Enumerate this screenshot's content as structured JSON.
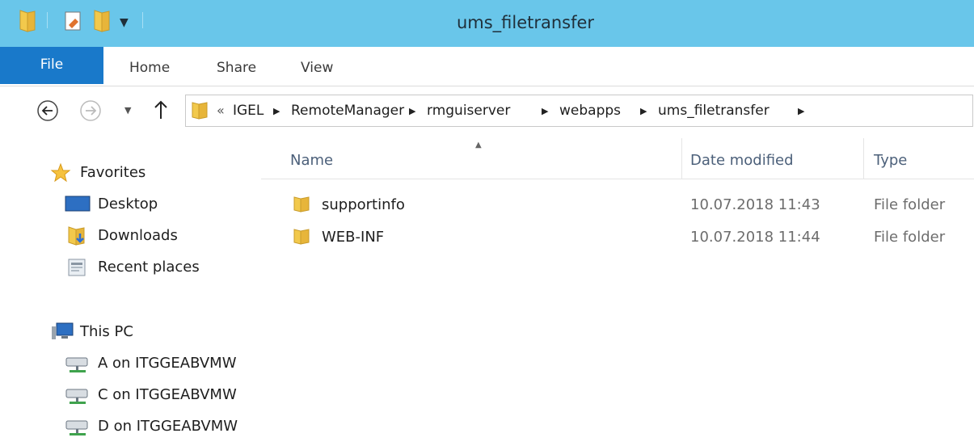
{
  "window": {
    "title": "ums_filetransfer"
  },
  "ribbon": {
    "tabs": [
      "File",
      "Home",
      "Share",
      "View"
    ]
  },
  "address": {
    "overflow": "«",
    "path": [
      "IGEL",
      "RemoteManager",
      "rmguiserver",
      "webapps",
      "ums_filetransfer"
    ]
  },
  "nav": {
    "favorites": "Favorites",
    "desktop": "Desktop",
    "downloads": "Downloads",
    "recent": "Recent places",
    "this_pc": "This PC",
    "drives": [
      "A on ITGGEABVMW",
      "C on ITGGEABVMW",
      "D on ITGGEABVMW"
    ]
  },
  "columns": {
    "name": "Name",
    "date": "Date modified",
    "type": "Type"
  },
  "files": [
    {
      "name": "supportinfo",
      "date": "10.07.2018 11:43",
      "type": "File folder"
    },
    {
      "name": "WEB-INF",
      "date": "10.07.2018 11:44",
      "type": "File folder"
    }
  ],
  "colors": {
    "titlebar": "#69c6ea",
    "file_tab": "#1979ca"
  }
}
